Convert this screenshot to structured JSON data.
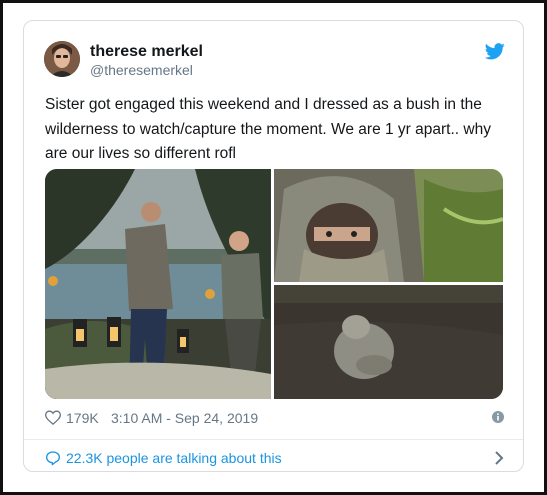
{
  "tweet": {
    "author": {
      "name": "therese merkel",
      "handle": "@theresemerkel"
    },
    "text": "Sister got engaged this weekend and I dressed as a bush in the wilderness to watch/capture the moment. We are 1 yr apart.. why are our lives so different rofl",
    "likes": "179K",
    "timestamp": "3:10 AM - Sep 24, 2019",
    "conversation": "22.3K people are talking about this"
  },
  "colors": {
    "link_blue": "#1b95e0",
    "twitter_blue": "#1da1f2",
    "text": "#14171a",
    "muted": "#657786",
    "border": "#d8dde1"
  },
  "icons": [
    "twitter-bird-icon",
    "heart-icon",
    "info-icon",
    "comment-icon",
    "chevron-right-icon"
  ]
}
